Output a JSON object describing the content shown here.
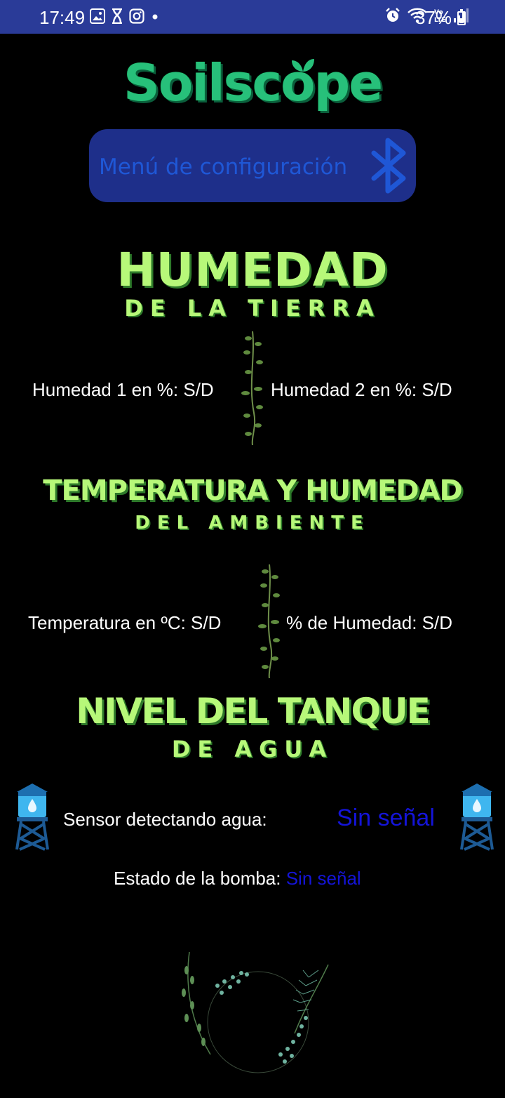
{
  "status_bar": {
    "time": "17:49",
    "battery": "37%",
    "left_icons": [
      "gallery-icon",
      "hourglass-icon",
      "instagram-icon",
      "dot-icon"
    ],
    "right_icons": [
      "alarm-icon",
      "wifi-icon",
      "volte-icon",
      "signal-icon"
    ]
  },
  "app": {
    "logo": "Soilscope",
    "config_button": "Menú de configuración"
  },
  "sections": {
    "soil": {
      "title": "HUMEDAD",
      "subtitle": "DE LA TIERRA",
      "humidity1": "Humedad 1 en %: S/D",
      "humidity2": "Humedad 2 en %: S/D"
    },
    "ambient": {
      "title": "TEMPERATURA Y HUMEDAD",
      "subtitle": "DEL AMBIENTE",
      "temperature": "Temperatura en ºC: S/D",
      "humidity": "% de Humedad:  S/D"
    },
    "tank": {
      "title": "NIVEL DEL TANQUE",
      "subtitle": "DE AGUA",
      "sensor_label": "Sensor detectando agua:",
      "sensor_value": "Sin señal",
      "pump_label": "Estado de la bomba: ",
      "pump_value": "Sin señal"
    }
  },
  "colors": {
    "heading": "#b7f879",
    "status_value": "#1414d8",
    "button_bg": "#1e2f8a",
    "statusbar_bg": "#2a3b98"
  }
}
